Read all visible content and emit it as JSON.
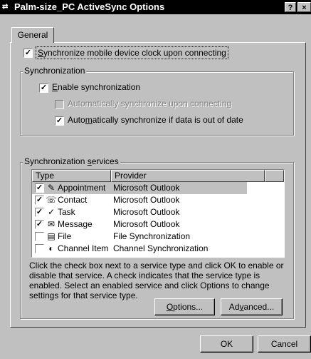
{
  "window": {
    "title": "Palm-size_PC ActiveSync Options",
    "help_button": "?",
    "close_button": "×"
  },
  "tabs": [
    {
      "label": "General"
    }
  ],
  "options": {
    "sync_clock": {
      "checked": true,
      "pre": "",
      "ul": "S",
      "post": "ynchronize mobile device clock upon connecting",
      "full": "Synchronize mobile device clock upon connecting"
    }
  },
  "synchronization": {
    "legend": "Synchronization",
    "enable": {
      "checked": true,
      "ul": "E",
      "post": "nable synchronization"
    },
    "auto_connect": {
      "checked": false,
      "disabled": true,
      "label": "Automatically synchronize upon connecting"
    },
    "auto_outdated": {
      "checked": true,
      "pre": "Auto",
      "ul": "m",
      "post": "atically synchronize if data is out of date"
    }
  },
  "services": {
    "legend_pre": "Synchronization ",
    "legend_ul": "s",
    "legend_post": "ervices",
    "columns": {
      "type": "Type",
      "provider": "Provider"
    },
    "rows": [
      {
        "checked": true,
        "icon": "appointment-icon",
        "glyph": "✎",
        "type": "Appointment",
        "provider": "Microsoft Outlook",
        "selected": true
      },
      {
        "checked": true,
        "icon": "contact-icon",
        "glyph": "☏",
        "type": "Contact",
        "provider": "Microsoft Outlook",
        "selected": false
      },
      {
        "checked": true,
        "icon": "task-icon",
        "glyph": "✓",
        "type": "Task",
        "provider": "Microsoft Outlook",
        "selected": false
      },
      {
        "checked": true,
        "icon": "message-icon",
        "glyph": "✉",
        "type": "Message",
        "provider": "Microsoft Outlook",
        "selected": false
      },
      {
        "checked": false,
        "icon": "file-icon",
        "glyph": "▤",
        "type": "File",
        "provider": "File Synchronization",
        "selected": false
      },
      {
        "checked": false,
        "icon": "channel-icon",
        "glyph": "◐",
        "type": "Channel Item",
        "provider": "Channel Synchronization",
        "selected": false
      }
    ],
    "description": "Click the check box next to a service type and click OK to enable or disable that service.  A check indicates that the service type is enabled.  Select an enabled service and click Options to change settings for that service type.",
    "options_button": {
      "ul": "O",
      "post": "ptions..."
    },
    "advanced_button": {
      "pre": "Ad",
      "ul": "v",
      "post": "anced..."
    }
  },
  "footer": {
    "ok": "OK",
    "cancel": "Cancel"
  }
}
